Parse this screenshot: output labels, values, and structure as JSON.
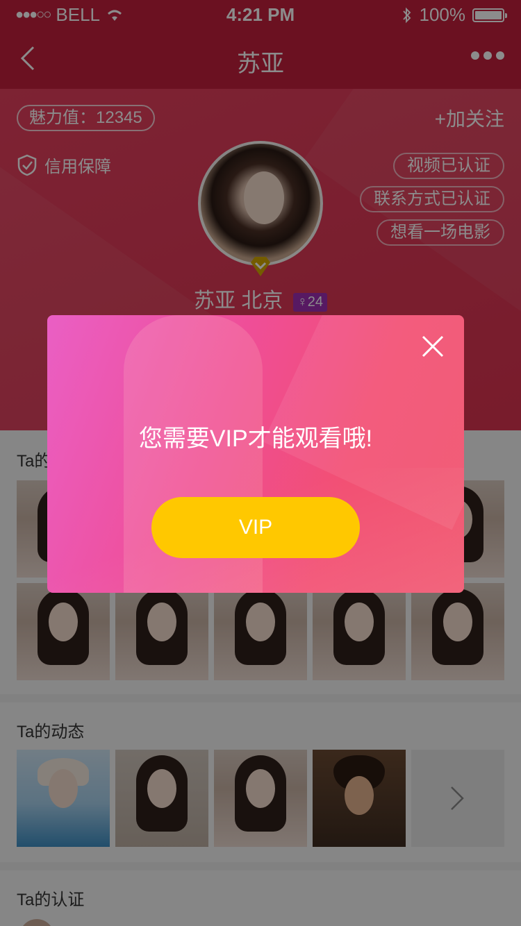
{
  "status_bar": {
    "signal": "●●●○○",
    "carrier": "BELL",
    "time": "4:21 PM",
    "battery_percent": "100%"
  },
  "nav": {
    "title": "苏亚"
  },
  "profile": {
    "charm_label": "魅力值：12345",
    "follow_label": "+加关注",
    "credit_label": "信用保障",
    "tags": [
      "视频已认证",
      "联系方式已认证",
      "想看一场电影"
    ],
    "name": "苏亚",
    "city": "北京",
    "age": "24"
  },
  "sections": {
    "photos_title_partial": "Ta的",
    "moments_title": "Ta的动态",
    "verification_title": "Ta的认证"
  },
  "modal": {
    "message": "您需要VIP才能观看哦!",
    "button_label": "VIP"
  },
  "colors": {
    "header": "#c41f3c",
    "vip_button": "#ffc800",
    "age_badge": "#9e2fb3"
  }
}
